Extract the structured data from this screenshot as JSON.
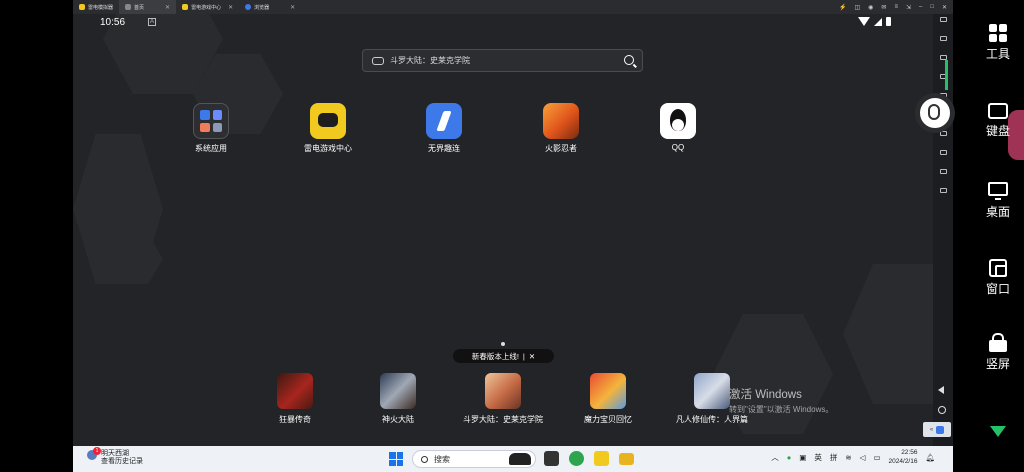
{
  "emulator": {
    "tabs": [
      {
        "label": "雷电模拟器",
        "color": "#f2c91f"
      },
      {
        "label": "首页",
        "color": "#888888"
      },
      {
        "label": "雷电游戏中心",
        "color": "#f2c91f"
      },
      {
        "label": "浏览器",
        "color": "#3d79e8"
      }
    ]
  },
  "status_bar": {
    "time": "10:56",
    "notification_icon": "A"
  },
  "search": {
    "text": "斗罗大陆：史莱克学院"
  },
  "apps": [
    {
      "label": "系统应用",
      "icon": "folder-icon"
    },
    {
      "label": "雷电游戏中心",
      "icon": "gamepad-icon"
    },
    {
      "label": "无界趣连",
      "icon": "lightning-icon"
    },
    {
      "label": "火影忍者",
      "icon": "naruto-icon"
    },
    {
      "label": "QQ",
      "icon": "penguin-icon"
    }
  ],
  "toast": {
    "text": "新春版本上线!",
    "sep": "|",
    "close": "✕"
  },
  "dock": [
    {
      "label": "狂暴传奇"
    },
    {
      "label": "神火大陆"
    },
    {
      "label": "斗罗大陆：史莱克学院"
    },
    {
      "label": "魔力宝贝回忆"
    },
    {
      "label": "凡人修仙传：人界篇"
    }
  ],
  "watermark": {
    "line1": "激活 Windows",
    "line2": "转到\"设置\"以激活 Windows。"
  },
  "right_panel": {
    "tools": "工具",
    "keyboard": "键盘",
    "desktop": "桌面",
    "window": "窗口",
    "portrait": "竖屏"
  },
  "taskbar": {
    "weather_line1": "明天西湖",
    "weather_line2": "查看历史记录",
    "weather_badge": "1",
    "search_placeholder": "搜索",
    "ime_1": "英",
    "ime_2": "拼",
    "time": "22:56",
    "date": "2024/2/16"
  }
}
